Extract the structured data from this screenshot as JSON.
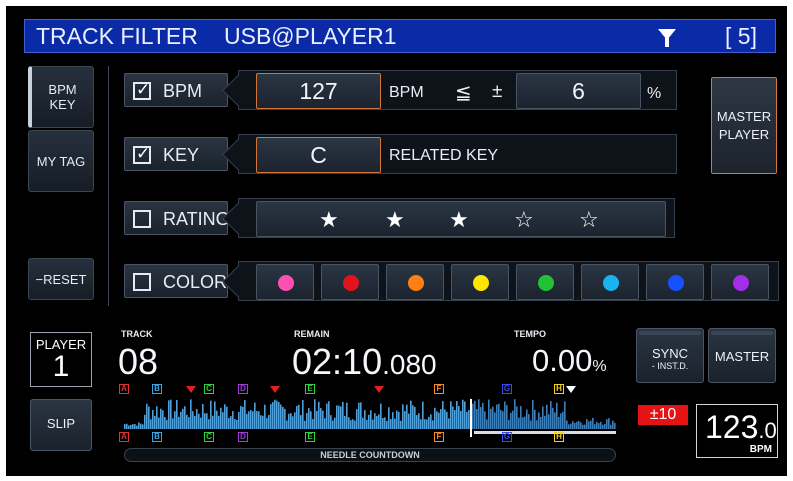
{
  "title_bar": {
    "left": "TRACK  FILTER",
    "source": "USB@PLAYER1",
    "count": "[  5]",
    "filter_icon": "filter-funnel-icon"
  },
  "left_buttons": {
    "bpm_key": "BPM\nKEY",
    "my_tag": "MY TAG",
    "reset": "−RESET"
  },
  "filters": {
    "bpm": {
      "checked": true,
      "label": "BPM",
      "value": "127",
      "unit": "BPM",
      "compare": "≦",
      "plusminus": "±",
      "range": "6",
      "percent": "%"
    },
    "key": {
      "checked": true,
      "label": "KEY",
      "value": "C",
      "related": "RELATED KEY"
    },
    "rating": {
      "checked": false,
      "label": "RATING",
      "stars": [
        "★",
        "★",
        "★",
        "☆",
        "☆"
      ],
      "rating_value": 3,
      "rating_max": 5
    },
    "color": {
      "checked": false,
      "label": "COLOR",
      "colors": [
        "#ff4fb0",
        "#e3131b",
        "#ff7f14",
        "#ffe600",
        "#22c232",
        "#19b4ef",
        "#1750ff",
        "#a52ce8"
      ]
    }
  },
  "master_player": "MASTER\nPLAYER",
  "deck": {
    "player_label": "PLAYER",
    "player_number": "1",
    "track_label": "TRACK",
    "track_number": "08",
    "remain_label": "REMAIN",
    "remain_main": "02:10",
    "remain_ms": ".080",
    "tempo_label": "TEMPO",
    "tempo_value": "0.00",
    "tempo_unit": "%",
    "slip": "SLIP",
    "sync": "SYNC",
    "sync_sub": "- INST.D.",
    "master": "MASTER",
    "pitch_range": "±10",
    "bpm_value": "123",
    "bpm_decimal": ".0",
    "bpm_unit": "BPM",
    "needle_label": "NEEDLE COUNTDOWN",
    "cue_labels": [
      "A",
      "B",
      "C",
      "D",
      "E",
      "F",
      "G",
      "H"
    ],
    "cue_colors": {
      "A": "#e4302d",
      "B": "#3ea3e6",
      "C": "#2fd23c",
      "D": "#a23ad8",
      "E": "#2fd23c",
      "F": "#ff8a1c",
      "G": "#3a4be6",
      "H": "#f4d21c"
    }
  }
}
